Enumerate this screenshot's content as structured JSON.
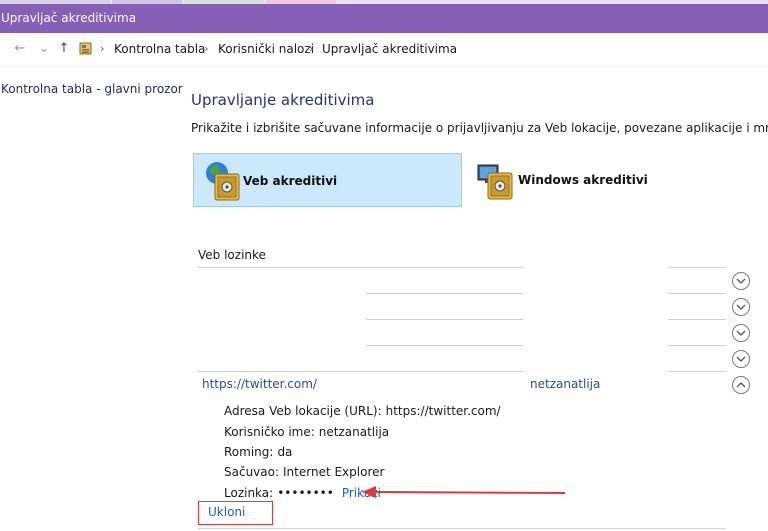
{
  "window": {
    "title": "Upravljač akreditivima"
  },
  "breadcrumb": {
    "items": [
      "Kontrolna tabla",
      "Korisnički nalozi",
      "Upravljač akreditivima"
    ],
    "separator": "›"
  },
  "nav": {
    "back": "←",
    "forward": "→",
    "recent": "⌄",
    "up": "↑"
  },
  "sidebar": {
    "home_link": "Kontrolna tabla - glavni prozor"
  },
  "main": {
    "title": "Upravljanje akreditivima",
    "description": "Prikažite i izbrišite sačuvane informacije o prijavljivanju za Veb lokacije, povezane aplikacije i mreže.",
    "tiles": [
      {
        "label": "Veb akreditivi",
        "icon": "globe-vault-icon",
        "active": true
      },
      {
        "label": "Windows akreditivi",
        "icon": "computer-vault-icon",
        "active": false
      }
    ],
    "section_title": "Veb lozinke",
    "entry": {
      "url": "https://twitter.com/",
      "username": "netzanatlija",
      "details": [
        {
          "label": "Adresa Veb lokacije (URL):",
          "value": "https://twitter.com/"
        },
        {
          "label": "Korisničko ime:",
          "value": "netzanatlija"
        },
        {
          "label": "Roming:",
          "value": "da"
        },
        {
          "label": "Sačuvao:",
          "value": "Internet Explorer"
        }
      ],
      "password_label": "Lozinka:",
      "password_mask": "••••••••",
      "show_link": "Prikaži",
      "remove_link": "Ukloni"
    }
  },
  "colors": {
    "titlebar": "#8660b7",
    "accent_link": "#1e5fb5",
    "heading": "#1e3287",
    "tile_active_bg": "#cce8fb",
    "annotation_red": "#e23a3a"
  }
}
